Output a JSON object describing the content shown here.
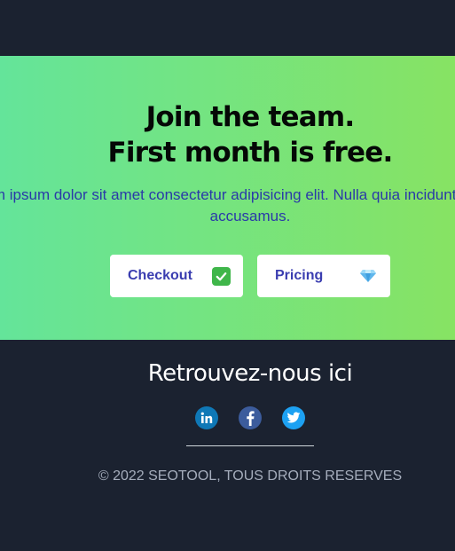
{
  "hero": {
    "title_line1": "Join the team.",
    "title_line2": "First month is free.",
    "text": "Lorem ipsum dolor sit amet consectetur adipisicing elit. Nulla quia incidunt alias eaque accusamus.",
    "buttons": [
      {
        "label": "Checkout",
        "icon": "check-mark-icon"
      },
      {
        "label": "Pricing",
        "icon": "gem-icon"
      }
    ]
  },
  "footer": {
    "title": "Retrouvez-nous ici",
    "socials": [
      {
        "name": "LinkedIn",
        "icon": "linkedin-icon",
        "color": "#0f78b6"
      },
      {
        "name": "Facebook",
        "icon": "facebook-icon",
        "color": "#3c5c9c"
      },
      {
        "name": "Twitter",
        "icon": "twitter-icon",
        "color": "#1da1f2"
      }
    ],
    "copyright": "© 2022 SEOTOOL, TOUS DROITS RESERVES"
  },
  "colors": {
    "background": "#1b2230",
    "gradient_start": "#64e49a",
    "gradient_end": "#87e363",
    "accent_text": "#2a3aa8",
    "button_text": "#3a3db0"
  }
}
